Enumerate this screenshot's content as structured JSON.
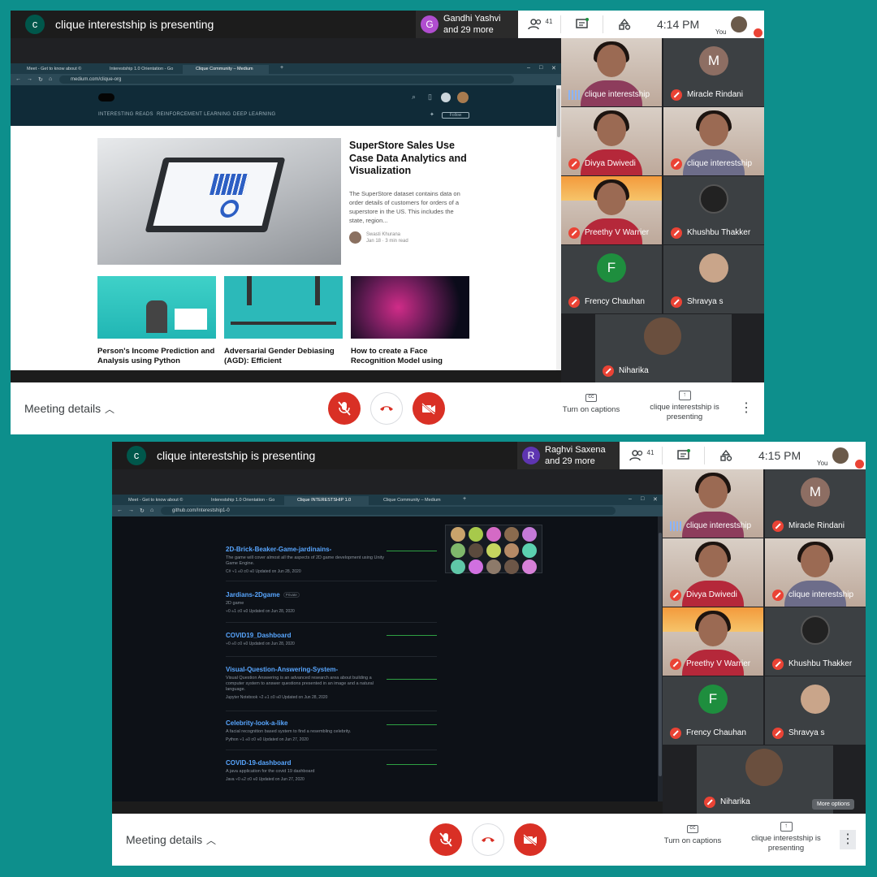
{
  "shot1": {
    "presenter_initial": "c",
    "presenter_title": "clique interestship is presenting",
    "notif_initial": "G",
    "notif_name": "Gandhi Yashvi",
    "notif_more": "and 29 more",
    "notif_color": "#b04dcf",
    "people_count": "41",
    "time": "4:14 PM",
    "you_label": "You",
    "browser": {
      "tabs": [
        "Meet - Get to know about ©",
        "Interestship 1.0 Orientation - Go",
        "Clique Community – Medium"
      ],
      "url": "medium.com/clique-org"
    },
    "medium": {
      "nav": [
        "INTERESTING READS",
        "REINFORCEMENT LEARNING",
        "DEEP LEARNING"
      ],
      "follow_btn": "Follow",
      "hero_title": "SuperStore Sales Use Case Data Analytics and Visualization",
      "hero_desc": "The SuperStore dataset contains data on order details of customers for orders of a superstore in the US. This includes the state, region...",
      "author_name": "Swasti Khurana",
      "author_meta": "Jan 18 · 3 min read",
      "thumb_titles": [
        "Person's Income Prediction and Analysis using Python",
        "Adversarial Gender Debiasing (AGD): Efficient",
        "How to create a Face Recognition Model using"
      ]
    },
    "participants": [
      {
        "name": "clique interestship",
        "type": "video",
        "speaking": true
      },
      {
        "name": "Miracle Rindani",
        "type": "avatar",
        "initial": "M",
        "color": "#8d6e63"
      },
      {
        "name": "Divya Dwivedi",
        "type": "video"
      },
      {
        "name": "clique interestship",
        "type": "video"
      },
      {
        "name": "Preethy V Warrier",
        "type": "video-solar"
      },
      {
        "name": "Khushbu Thakker",
        "type": "photo"
      },
      {
        "name": "Frency Chauhan",
        "type": "avatar",
        "initial": "F",
        "color": "#1e8e3e"
      },
      {
        "name": "Shravya s",
        "type": "photo"
      },
      {
        "name": "Niharika",
        "type": "photo"
      }
    ],
    "bottom": {
      "meeting_details": "Meeting details",
      "captions": "Turn on captions",
      "presenting": "clique interestship is presenting"
    }
  },
  "shot2": {
    "presenter_initial": "c",
    "presenter_title": "clique interestship is presenting",
    "notif_initial": "R",
    "notif_name": "Raghvi Saxena",
    "notif_more": "and 29 more",
    "notif_color": "#5e35b1",
    "people_count": "41",
    "time": "4:15 PM",
    "you_label": "You",
    "browser": {
      "tabs": [
        "Meet - Get to know about ©",
        "Interestship 1.0 Orientation - Go",
        "Clique INTERESTSHIP 1.0",
        "Clique Community – Medium"
      ],
      "url": "github.com/Interestship1-0"
    },
    "repos": [
      {
        "name": "2D-Brick-Beaker-Game-jardinains-",
        "desc": "The game will cover almost all the aspects of 2D game development using Unity Game Engine.",
        "meta": "C#  ⑂1  ☆0  ⊙0  ⇅0  Updated on Jun 28, 2020"
      },
      {
        "name": "Jardians-2Dgame",
        "badge": "Private",
        "desc": "2D game",
        "meta": "⑂0  ☆1  ⊙0  ⇅0  Updated on Jun 28, 2020"
      },
      {
        "name": "COVID19_Dashboard",
        "desc": "",
        "meta": "⑂0  ☆0  ⊙0  ⇅0  Updated on Jun 28, 2020"
      },
      {
        "name": "Visual-Question-Answering-System-",
        "desc": "Visual Question Answering is an advanced research area about building a computer system to answer questions presented in an image and a natural language.",
        "meta": "Jupyter Notebook  ⑂2  ☆1  ⊙0  ⇅0  Updated on Jun 28, 2020"
      },
      {
        "name": "Celebrity-look-a-like",
        "desc": "A facial recognition based system to find a resembling celebrity.",
        "meta": "Python  ⑂1  ☆0  ⊙0  ⇅0  Updated on Jun 27, 2020"
      },
      {
        "name": "COVID-19-dashboard",
        "desc": "A java application for the covid 19 dashboard",
        "meta": "Java  ⑂0  ☆2  ⊙0  ⇅0  Updated on Jun 27, 2020"
      }
    ],
    "participants": [
      {
        "name": "clique interestship",
        "type": "video",
        "speaking": true
      },
      {
        "name": "Miracle Rindani",
        "type": "avatar",
        "initial": "M",
        "color": "#8d6e63"
      },
      {
        "name": "Divya Dwivedi",
        "type": "video"
      },
      {
        "name": "clique interestship",
        "type": "video"
      },
      {
        "name": "Preethy V Warrier",
        "type": "video-solar"
      },
      {
        "name": "Khushbu Thakker",
        "type": "photo"
      },
      {
        "name": "Frency Chauhan",
        "type": "avatar",
        "initial": "F",
        "color": "#1e8e3e"
      },
      {
        "name": "Shravya s",
        "type": "photo"
      },
      {
        "name": "Niharika",
        "type": "photo"
      }
    ],
    "tooltip": "More options",
    "bottom": {
      "meeting_details": "Meeting details",
      "captions": "Turn on captions",
      "presenting": "clique interestship is presenting"
    }
  },
  "colors": {
    "accent_red": "#d93025",
    "teal_background": "#0d8f8c",
    "dark_bg": "#202124"
  }
}
